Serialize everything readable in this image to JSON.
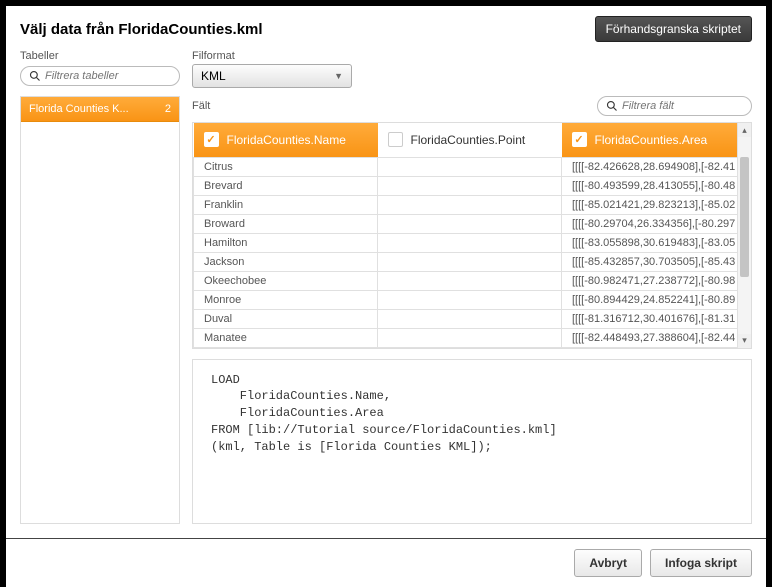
{
  "header": {
    "title": "Välj data från FloridaCounties.kml",
    "preview_btn": "Förhandsgranska skriptet"
  },
  "labels": {
    "tables": "Tabeller",
    "fileformat": "Filformat",
    "fields": "Fält"
  },
  "inputs": {
    "filter_tables_ph": "Filtrera tabeller",
    "filter_fields_ph": "Filtrera fält",
    "dropdown_value": "KML"
  },
  "sidebar": {
    "items": [
      {
        "name": "Florida Counties K...",
        "count": "2"
      }
    ]
  },
  "columns": [
    {
      "label": "FloridaCounties.Name",
      "selected": true
    },
    {
      "label": "FloridaCounties.Point",
      "selected": false
    },
    {
      "label": "FloridaCounties.Area",
      "selected": true
    }
  ],
  "rows": [
    {
      "name": "Citrus",
      "point": "",
      "area": "[[[[-82.426628,28.694908],[-82.41"
    },
    {
      "name": "Brevard",
      "point": "",
      "area": "[[[[-80.493599,28.413055],[-80.48"
    },
    {
      "name": "Franklin",
      "point": "",
      "area": "[[[[-85.021421,29.823213],[-85.02"
    },
    {
      "name": "Broward",
      "point": "",
      "area": "[[[[-80.29704,26.334356],[-80.297"
    },
    {
      "name": "Hamilton",
      "point": "",
      "area": "[[[[-83.055898,30.619483],[-83.05"
    },
    {
      "name": "Jackson",
      "point": "",
      "area": "[[[[-85.432857,30.703505],[-85.43"
    },
    {
      "name": "Okeechobee",
      "point": "",
      "area": "[[[[-80.982471,27.238772],[-80.98"
    },
    {
      "name": "Monroe",
      "point": "",
      "area": "[[[[-80.894429,24.852241],[-80.89"
    },
    {
      "name": "Duval",
      "point": "",
      "area": "[[[[-81.316712,30.401676],[-81.31"
    },
    {
      "name": "Manatee",
      "point": "",
      "area": "[[[[-82.448493,27.388604],[-82.44"
    }
  ],
  "script": "LOAD\n    FloridaCounties.Name,\n    FloridaCounties.Area\nFROM [lib://Tutorial source/FloridaCounties.kml]\n(kml, Table is [Florida Counties KML]);",
  "footer": {
    "cancel": "Avbryt",
    "insert": "Infoga skript"
  }
}
